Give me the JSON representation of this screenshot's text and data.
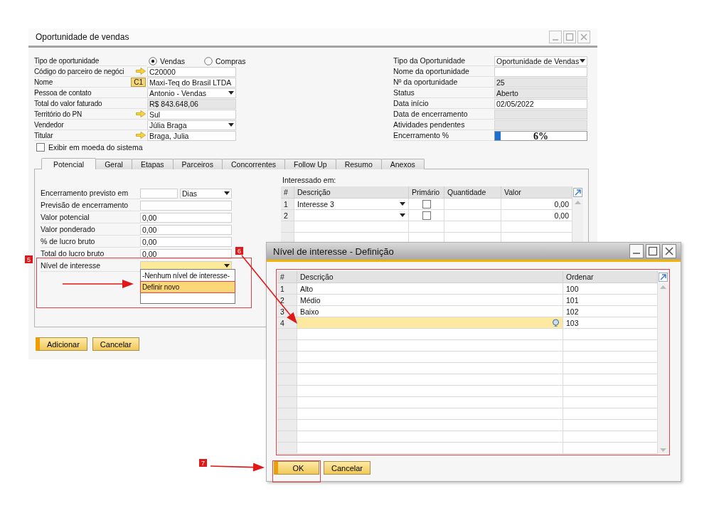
{
  "window": {
    "title": "Oportunidade de vendas"
  },
  "header_left": [
    {
      "label": "Tipo de oportunidade",
      "kind": "radio",
      "options": [
        {
          "label": "Vendas",
          "selected": true
        },
        {
          "label": "Compras",
          "selected": false
        }
      ]
    },
    {
      "label": "Código do parceiro de negóci",
      "kind": "link",
      "value": "C20000"
    },
    {
      "label": "Nome",
      "kind": "badge",
      "badge": "C1",
      "value": "Maxi-Teq do Brasil LTDA"
    },
    {
      "label": "Pessoa de contato",
      "kind": "dropdown",
      "value": "Antonio - Vendas"
    },
    {
      "label": "Total do valor faturado",
      "kind": "readonly",
      "value": "R$ 843.648,06"
    },
    {
      "label": "Território do PN",
      "kind": "link",
      "value": "Sul"
    },
    {
      "label": "Vendedor",
      "kind": "dropdown",
      "value": "Júlia Braga"
    },
    {
      "label": "Titular",
      "kind": "link",
      "value": "Braga, Julia"
    }
  ],
  "system_currency": {
    "label": "Exibir em moeda do sistema",
    "checked": false
  },
  "header_right": [
    {
      "label": "Tipo da Oportunidade",
      "kind": "dropdown",
      "value": "Oportunidade de Vendas"
    },
    {
      "label": "Nome da oportunidade",
      "kind": "text"
    },
    {
      "label": "Nº da oportunidade",
      "kind": "readonly",
      "value": "25"
    },
    {
      "label": "Status",
      "kind": "readonly",
      "value": "Aberto"
    },
    {
      "label": "Data início",
      "kind": "text",
      "value": "02/05/2022"
    },
    {
      "label": "Data de encerramento",
      "kind": "readonly"
    },
    {
      "label": "Atividades pendentes",
      "kind": "readonly"
    },
    {
      "label": "Encerramento %",
      "kind": "progress",
      "level": 0.06,
      "value": "6%"
    }
  ],
  "tabs": [
    {
      "label": "Potencial",
      "selected": true
    },
    {
      "label": "Geral",
      "selected": false
    },
    {
      "label": "Etapas",
      "selected": false
    },
    {
      "label": "Parceiros",
      "selected": false
    },
    {
      "label": "Concorrentes",
      "selected": false
    },
    {
      "label": "Follow Up",
      "selected": false
    },
    {
      "label": "Resumo",
      "selected": false
    },
    {
      "label": "Anexos",
      "selected": false
    }
  ],
  "potential_fields": [
    {
      "label": "Encerramento previsto em",
      "kind": "period",
      "unit": "Dias",
      "focused": false
    },
    {
      "label": "Previsão de encerramento",
      "kind": "text",
      "focused": false
    },
    {
      "label": "Valor potencial",
      "kind": "text",
      "value": "0,00",
      "focused": false
    },
    {
      "label": "Valor ponderado",
      "kind": "text",
      "value": "0,00",
      "focused": false
    },
    {
      "label": "% de lucro bruto",
      "kind": "text",
      "value": "0,00",
      "focused": false
    },
    {
      "label": "Total do lucro bruto",
      "kind": "text",
      "value": "0,00",
      "focused": false
    },
    {
      "label": "Nível de interesse",
      "kind": "dropdown",
      "focused": true
    }
  ],
  "dropdown_menu": {
    "options": [
      {
        "label": "-Nenhum nível de interesse-",
        "selected": false
      },
      {
        "label": "Definir novo",
        "selected": true
      }
    ]
  },
  "interests": {
    "caption": "Interessado em:",
    "columns": [
      "#",
      "Descrição",
      "Primário",
      "Quantidade",
      "Valor"
    ],
    "rows": [
      {
        "number": "1",
        "description": "Interesse 3",
        "primary": false,
        "value": "0,00"
      },
      {
        "number": "2",
        "primary": false,
        "value": "0,00"
      }
    ]
  },
  "buttons": [
    {
      "label": "Adicionar",
      "primary": true
    },
    {
      "label": "Cancelar",
      "primary": false
    }
  ],
  "dialog": {
    "title": "Nível de interesse - Definição",
    "columns": [
      "#",
      "Descrição",
      "Ordenar"
    ],
    "rows": [
      {
        "number": "1",
        "description": "Alto",
        "order": "100",
        "selected": false
      },
      {
        "number": "2",
        "description": "Médio",
        "order": "101",
        "selected": false
      },
      {
        "number": "3",
        "description": "Baixo",
        "order": "102",
        "selected": false
      },
      {
        "number": "4",
        "order": "103",
        "selected": true
      }
    ],
    "buttons": [
      {
        "label": "OK",
        "primary": true
      },
      {
        "label": "Cancelar",
        "primary": false
      }
    ]
  },
  "annotations": [
    {
      "label": "5"
    },
    {
      "label": "6"
    },
    {
      "label": "7"
    }
  ]
}
